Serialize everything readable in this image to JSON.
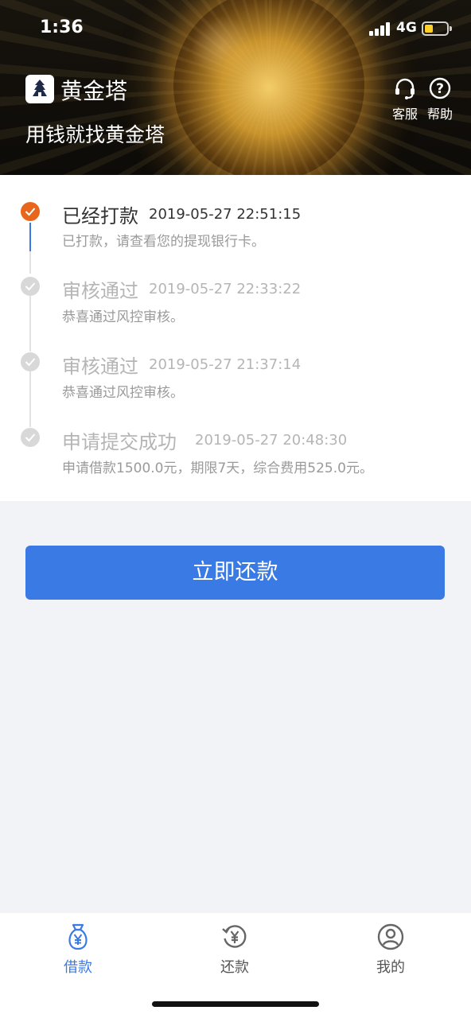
{
  "status_bar": {
    "time": "1:36",
    "network": "4G",
    "battery_level": 0.4
  },
  "header": {
    "app_name": "黄金塔",
    "slogan": "用钱就找黄金塔",
    "service_label": "客服",
    "help_label": "帮助",
    "help_glyph": "?"
  },
  "timeline": [
    {
      "title": "已经打款",
      "time": "2019-05-27 22:51:15",
      "desc": "已打款，请查看您的提现银行卡。",
      "status": "active"
    },
    {
      "title": "审核通过",
      "time": "2019-05-27 22:33:22",
      "desc": "恭喜通过风控审核。",
      "status": "done"
    },
    {
      "title": "审核通过",
      "time": "2019-05-27 21:37:14",
      "desc": "恭喜通过风控审核。",
      "status": "done"
    },
    {
      "title": "申请提交成功",
      "time": "2019-05-27 20:48:30",
      "desc": "申请借款1500.0元，期限7天，综合费用525.0元。",
      "status": "done"
    }
  ],
  "repay_button": {
    "label": "立即还款"
  },
  "tabbar": {
    "tabs": [
      {
        "label": "借款",
        "icon": "money-bag-icon",
        "active": true
      },
      {
        "label": "还款",
        "icon": "yen-refresh-icon",
        "active": false
      },
      {
        "label": "我的",
        "icon": "user-icon",
        "active": false
      }
    ]
  },
  "colors": {
    "accent": "#3a7ae4",
    "active_step": "#e8661c",
    "inactive_step": "#d8d8d8",
    "battery": "#ffd028"
  }
}
